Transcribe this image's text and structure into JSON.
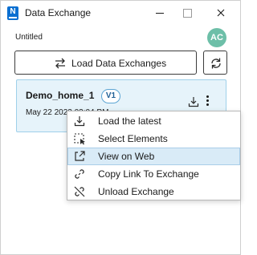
{
  "window": {
    "title": "Data Exchange",
    "app_icon_letter": "N"
  },
  "document": {
    "name": "Untitled"
  },
  "user": {
    "initials": "AC",
    "avatar_color": "#6dbfa8"
  },
  "toolbar": {
    "load_label": "Load Data Exchanges",
    "load_icon": "swap-arrows-icon",
    "refresh_icon": "refresh-icon"
  },
  "exchange_card": {
    "name": "Demo_home_1",
    "version": "V1",
    "date": "May 22 2023 03:04 PM",
    "download_icon": "download-icon",
    "more_icon": "more-vertical-icon"
  },
  "context_menu": {
    "items": [
      {
        "label": "Load the latest",
        "icon": "download-icon",
        "active": false
      },
      {
        "label": "Select Elements",
        "icon": "select-elements-icon",
        "active": false
      },
      {
        "label": "View on Web",
        "icon": "external-link-icon",
        "active": true
      },
      {
        "label": "Copy Link To Exchange",
        "icon": "link-icon",
        "active": false
      },
      {
        "label": "Unload Exchange",
        "icon": "unlink-icon",
        "active": false
      }
    ]
  },
  "colors": {
    "accent": "#0a6fd1",
    "card_bg": "#e6f3fa",
    "card_border": "#9fd0ea",
    "menu_highlight": "#d9ebf7"
  }
}
